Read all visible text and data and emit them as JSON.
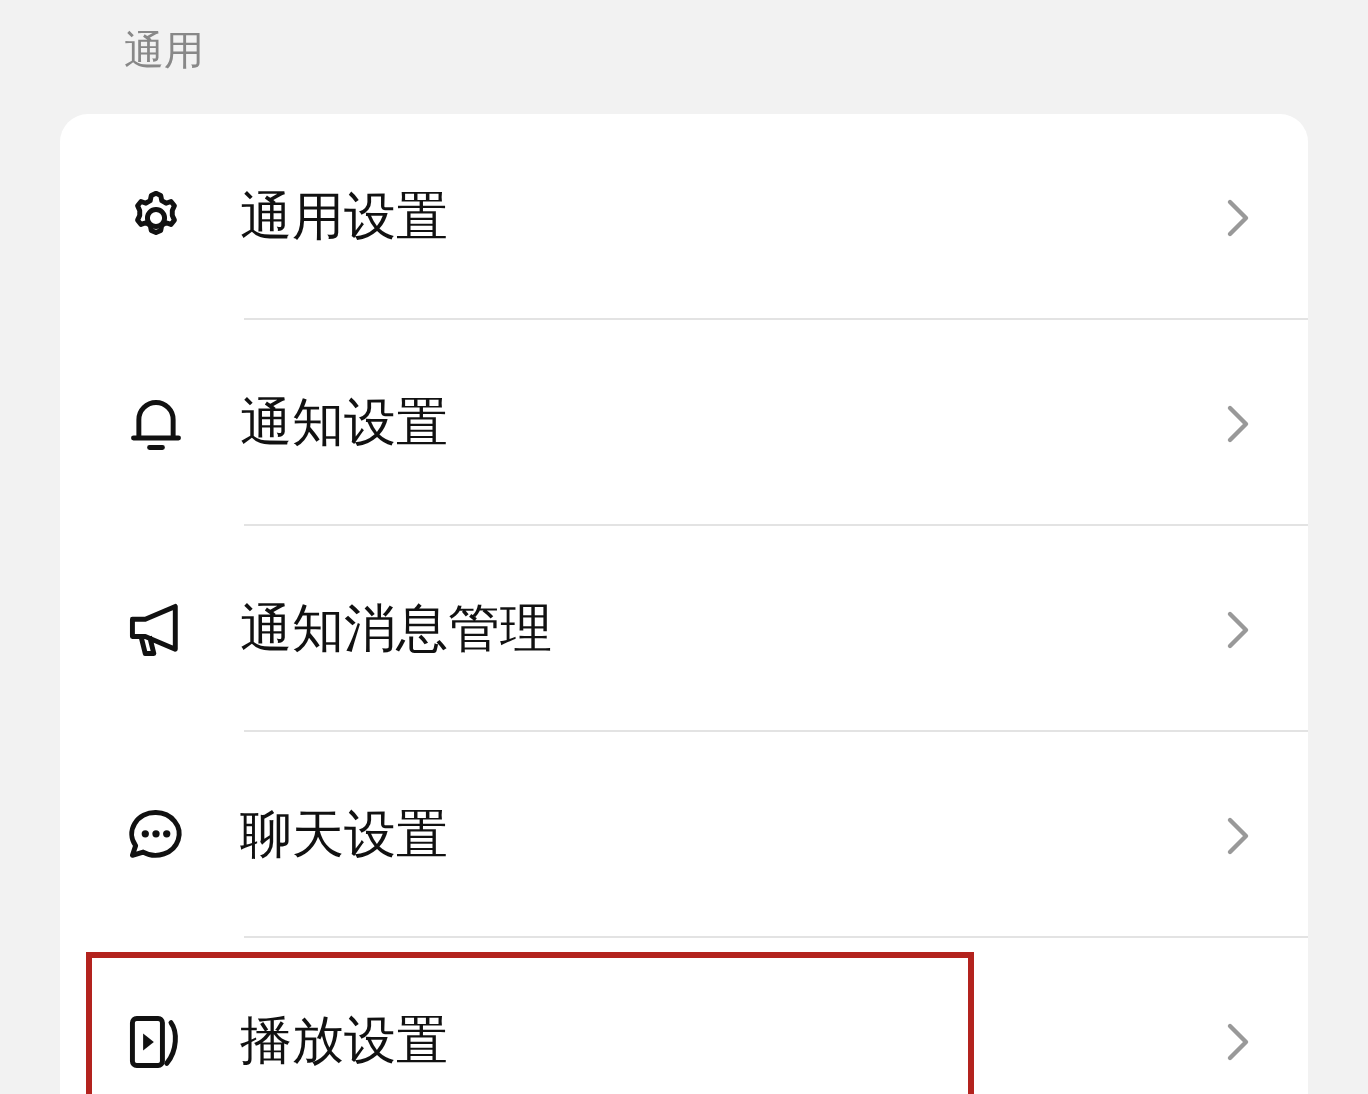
{
  "section_title": "通用",
  "items": [
    {
      "label": "通用设置",
      "highlighted": false
    },
    {
      "label": "通知设置",
      "highlighted": false
    },
    {
      "label": "通知消息管理",
      "highlighted": false
    },
    {
      "label": "聊天设置",
      "highlighted": false
    },
    {
      "label": "播放设置",
      "highlighted": true
    }
  ]
}
